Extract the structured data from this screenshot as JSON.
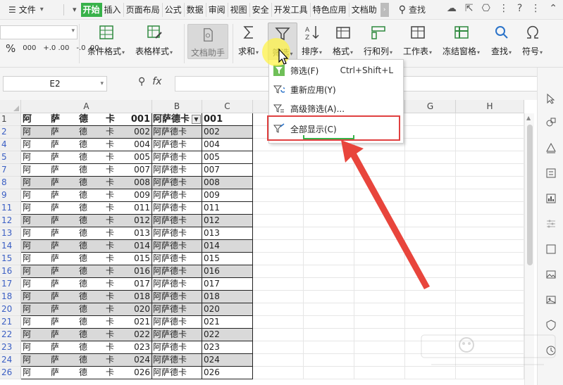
{
  "menu": {
    "file": "文件",
    "tabs": [
      "开始",
      "插入",
      "页面布局",
      "公式",
      "数据",
      "审阅",
      "视图",
      "安全",
      "开发工具",
      "特色应用",
      "文档助"
    ],
    "search": "查找"
  },
  "ribbon": {
    "number_buttons": [
      "%",
      "000",
      "+.0 .00",
      "-.0 .00"
    ],
    "buttons": [
      {
        "label": "条件格式",
        "icon": "conditional-format-icon"
      },
      {
        "label": "表格样式",
        "icon": "table-style-icon"
      },
      {
        "label": "文档助手",
        "icon": "doc-assistant-icon"
      },
      {
        "label": "求和",
        "icon": "sum-icon"
      },
      {
        "label": "筛选",
        "icon": "filter-icon"
      },
      {
        "label": "排序",
        "icon": "sort-icon"
      },
      {
        "label": "格式",
        "icon": "format-icon"
      },
      {
        "label": "行和列",
        "icon": "rows-cols-icon"
      },
      {
        "label": "工作表",
        "icon": "sheet-icon"
      },
      {
        "label": "冻结窗格",
        "icon": "freeze-icon"
      },
      {
        "label": "查找",
        "icon": "find-icon"
      },
      {
        "label": "符号",
        "icon": "symbol-icon"
      }
    ]
  },
  "formula_bar": {
    "name_box": "E2",
    "fx": "fx"
  },
  "columns": [
    "A",
    "B",
    "C",
    "",
    "",
    "F",
    "G",
    "H"
  ],
  "header_row": {
    "row": "1",
    "a": [
      "阿",
      "萨",
      "德",
      "卡",
      "001"
    ],
    "b": "阿萨德卡",
    "c": "001"
  },
  "rows": [
    {
      "row": "2",
      "n": "002",
      "b": "阿萨德卡",
      "c": "002",
      "grey": true
    },
    {
      "row": "4",
      "n": "004",
      "b": "阿萨德卡",
      "c": "004",
      "grey": false
    },
    {
      "row": "5",
      "n": "005",
      "b": "阿萨德卡",
      "c": "005",
      "grey": false
    },
    {
      "row": "7",
      "n": "007",
      "b": "阿萨德卡",
      "c": "007",
      "grey": false
    },
    {
      "row": "8",
      "n": "008",
      "b": "阿萨德卡",
      "c": "008",
      "grey": true
    },
    {
      "row": "9",
      "n": "009",
      "b": "阿萨德卡",
      "c": "009",
      "grey": false
    },
    {
      "row": "11",
      "n": "011",
      "b": "阿萨德卡",
      "c": "011",
      "grey": false
    },
    {
      "row": "12",
      "n": "012",
      "b": "阿萨德卡",
      "c": "012",
      "grey": true
    },
    {
      "row": "13",
      "n": "013",
      "b": "阿萨德卡",
      "c": "013",
      "grey": false
    },
    {
      "row": "14",
      "n": "014",
      "b": "阿萨德卡",
      "c": "014",
      "grey": true
    },
    {
      "row": "15",
      "n": "015",
      "b": "阿萨德卡",
      "c": "015",
      "grey": false
    },
    {
      "row": "16",
      "n": "016",
      "b": "阿萨德卡",
      "c": "016",
      "grey": true
    },
    {
      "row": "17",
      "n": "017",
      "b": "阿萨德卡",
      "c": "017",
      "grey": false
    },
    {
      "row": "18",
      "n": "018",
      "b": "阿萨德卡",
      "c": "018",
      "grey": true
    },
    {
      "row": "20",
      "n": "020",
      "b": "阿萨德卡",
      "c": "020",
      "grey": true
    },
    {
      "row": "21",
      "n": "021",
      "b": "阿萨德卡",
      "c": "021",
      "grey": false
    },
    {
      "row": "22",
      "n": "022",
      "b": "阿萨德卡",
      "c": "022",
      "grey": true
    },
    {
      "row": "23",
      "n": "023",
      "b": "阿萨德卡",
      "c": "023",
      "grey": false
    },
    {
      "row": "24",
      "n": "024",
      "b": "阿萨德卡",
      "c": "024",
      "grey": true
    },
    {
      "row": "26",
      "n": "026",
      "b": "阿萨德卡",
      "c": "026",
      "grey": false
    }
  ],
  "row_chars": [
    "阿",
    "萨",
    "德",
    "卡"
  ],
  "filter_menu": {
    "items": [
      {
        "label": "筛选(F)",
        "shortcut": "Ctrl+Shift+L"
      },
      {
        "label": "重新应用(Y)",
        "shortcut": ""
      },
      {
        "label": "高级筛选(A)...",
        "shortcut": ""
      },
      {
        "label": "全部显示(C)",
        "shortcut": ""
      }
    ]
  },
  "colors": {
    "active_tab": "#38b24a",
    "highlight": "#e04040",
    "arrow": "#e8453c",
    "row_number": "#3b5fc4",
    "filtered_fill": "#d9d9d9"
  }
}
